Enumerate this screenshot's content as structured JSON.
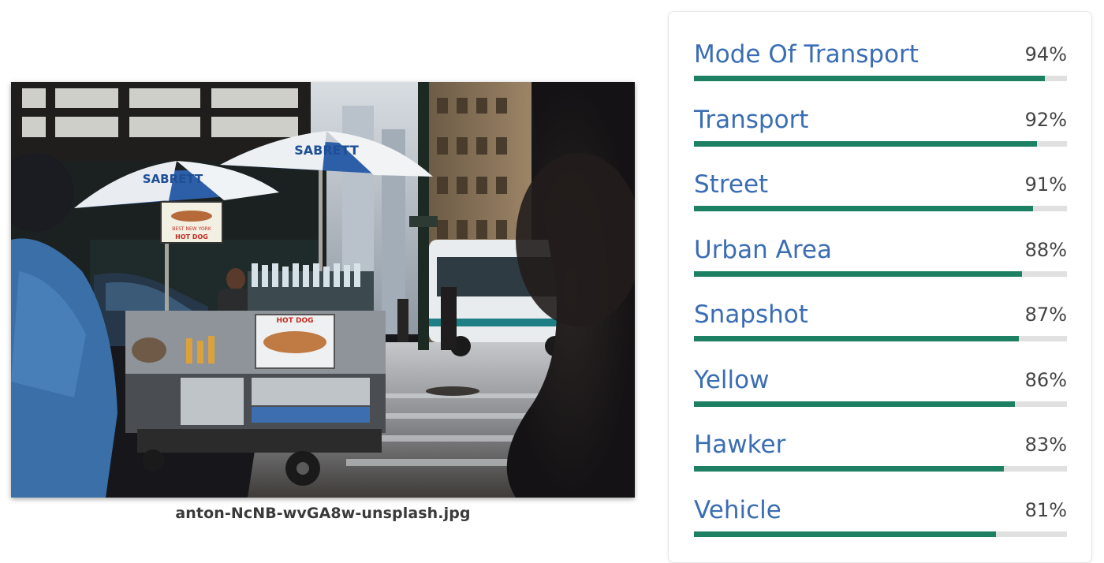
{
  "image": {
    "filename": "anton-NcNB-wvGA8w-unsplash.jpg",
    "umbrella_text": "SABRETT",
    "cart_sign_1": "BEST NEW YORK",
    "cart_sign_2": "HOT DOG",
    "cart_panel_text": "HOT DOG"
  },
  "labels": [
    {
      "name": "Mode Of Transport",
      "score_text": "94%",
      "score": 0.94
    },
    {
      "name": "Transport",
      "score_text": "92%",
      "score": 0.92
    },
    {
      "name": "Street",
      "score_text": "91%",
      "score": 0.91
    },
    {
      "name": "Urban Area",
      "score_text": "88%",
      "score": 0.88
    },
    {
      "name": "Snapshot",
      "score_text": "87%",
      "score": 0.87
    },
    {
      "name": "Yellow",
      "score_text": "86%",
      "score": 0.86
    },
    {
      "name": "Hawker",
      "score_text": "83%",
      "score": 0.83
    },
    {
      "name": "Vehicle",
      "score_text": "81%",
      "score": 0.81
    }
  ],
  "colors": {
    "label_text": "#3a6db4",
    "bar_fill": "#1e8062",
    "bar_track": "#e0e0e0",
    "score_text": "#444444"
  }
}
